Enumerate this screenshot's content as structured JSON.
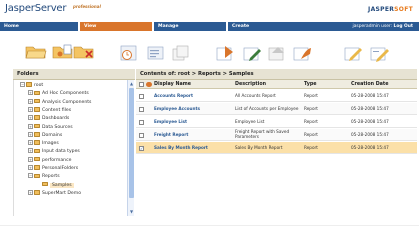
{
  "header": {
    "app_title": "JasperServer",
    "edition": "professional",
    "brand_left": "JASPER",
    "brand_right": "SOFT"
  },
  "nav": {
    "tabs": [
      {
        "label": "Home"
      },
      {
        "label": "View"
      },
      {
        "label": "Manage"
      },
      {
        "label": "Create"
      }
    ],
    "active_tab": "View",
    "user_text": "jasperadmin user:",
    "logout_label": "Log Out"
  },
  "toolbar": {
    "icons": [
      "open-folder-icon",
      "folder-properties-icon",
      "delete-folder-icon",
      "schedule-icon",
      "report-options-icon",
      "copy-icon",
      "run-report-icon",
      "edit-icon",
      "add-resource-icon",
      "move-icon",
      "report-edit-icon",
      "notes-icon"
    ]
  },
  "folders_panel": {
    "title": "Folders",
    "tree": [
      {
        "label": "root",
        "level": 0,
        "toggle": "−"
      },
      {
        "label": "Ad Hoc Components",
        "level": 1,
        "toggle": "+"
      },
      {
        "label": "Analysis Components",
        "level": 1,
        "toggle": "+"
      },
      {
        "label": "Content files",
        "level": 1,
        "toggle": "+"
      },
      {
        "label": "Dashboards",
        "level": 1,
        "toggle": "+"
      },
      {
        "label": "Data Sources",
        "level": 1,
        "toggle": "+"
      },
      {
        "label": "Domains",
        "level": 1,
        "toggle": "+"
      },
      {
        "label": "Images",
        "level": 1,
        "toggle": "+"
      },
      {
        "label": "Input data types",
        "level": 1,
        "toggle": "+"
      },
      {
        "label": "performance",
        "level": 1,
        "toggle": "+"
      },
      {
        "label": "PersonalFolders",
        "level": 1,
        "toggle": "+"
      },
      {
        "label": "Reports",
        "level": 1,
        "toggle": "−"
      },
      {
        "label": "Samples",
        "level": 2,
        "toggle": "",
        "selected": true
      },
      {
        "label": "SuperMart Demo",
        "level": 1,
        "toggle": "+"
      }
    ]
  },
  "contents_panel": {
    "title": "Contents of: root > Reports > Samples",
    "columns": {
      "name": "Display Name",
      "description": "Description",
      "type": "Type",
      "date": "Creation Date"
    },
    "rows": [
      {
        "name": "Accounts Report",
        "description": "All Accounts Report",
        "type": "Report",
        "date": "05-28-2008 15:47",
        "checked": false
      },
      {
        "name": "Employee Accounts",
        "description": "List of Accounts per Employee",
        "type": "Report",
        "date": "05-28-2008 15:47",
        "checked": false
      },
      {
        "name": "Employee List",
        "description": "Employee List",
        "type": "Report",
        "date": "05-28-2008 15:47",
        "checked": false
      },
      {
        "name": "Freight Report",
        "description": "Freight Report with Saved Parameters",
        "type": "Report",
        "date": "05-28-2008 15:47",
        "checked": false
      },
      {
        "name": "Sales By Month Report",
        "description": "Sales By Month Report",
        "type": "Report",
        "date": "05-28-2008 15:47",
        "checked": true
      }
    ]
  },
  "colors": {
    "nav_bg": "#2b5a93",
    "nav_active": "#d9752b",
    "panel_header": "#e7e3d3",
    "selected_row": "#fbe0a8",
    "link": "#2b5a93"
  }
}
